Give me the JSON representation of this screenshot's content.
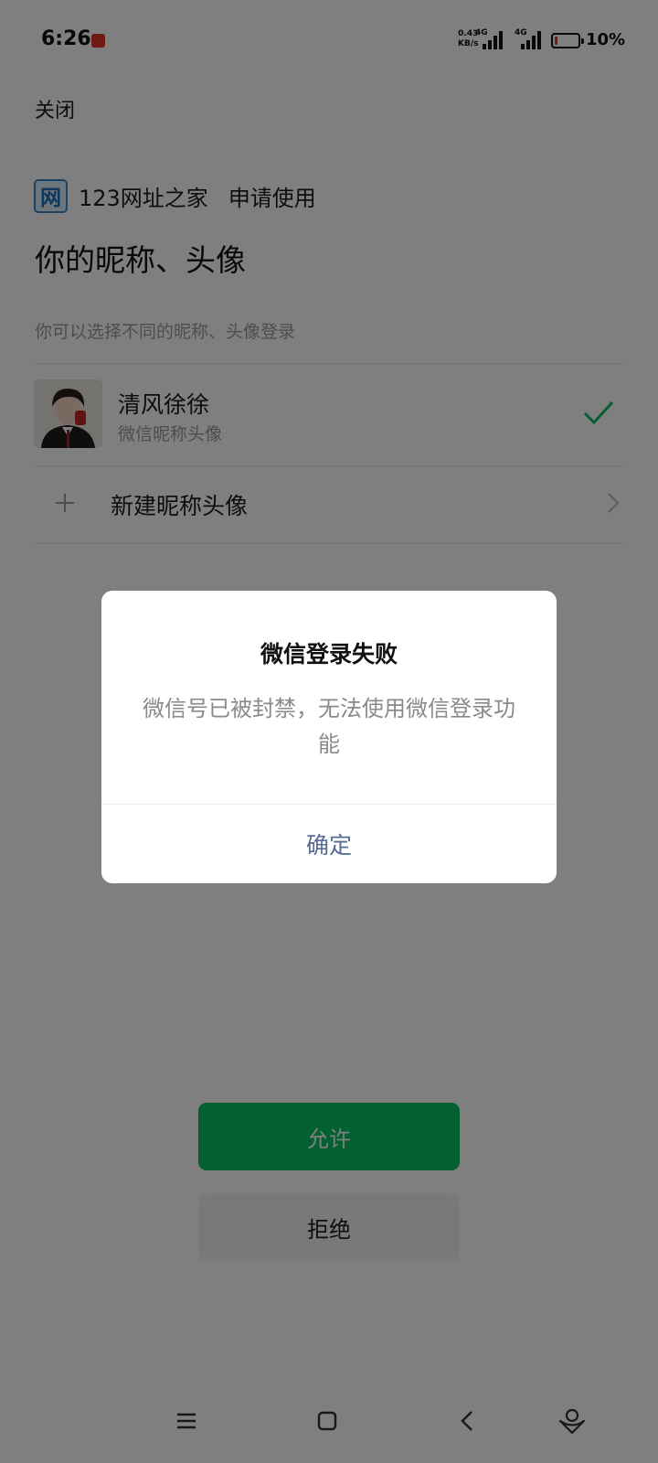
{
  "status_bar": {
    "time": "6:26",
    "net_speed_value": "0.43",
    "net_speed_unit": "KB/s",
    "network_1": "4G",
    "network_2": "4G",
    "battery_percent": "10%",
    "battery_level": 0.1
  },
  "page": {
    "close_label": "关闭",
    "app_icon_glyph": "网",
    "app_name": "123网址之家",
    "request_label": "申请使用",
    "title": "你的昵称、头像",
    "subtitle": "你可以选择不同的昵称、头像登录",
    "profile": {
      "name": "清风徐徐",
      "sub": "微信昵称头像",
      "selected": true
    },
    "new_profile_label": "新建昵称头像",
    "allow_label": "允许",
    "deny_label": "拒绝"
  },
  "dialog": {
    "title": "微信登录失败",
    "message": "微信号已被封禁，无法使用微信登录功能",
    "ok_label": "确定"
  },
  "navbar": {
    "icons": [
      "menu-icon",
      "home-icon",
      "back-icon",
      "assistant-icon"
    ]
  },
  "colors": {
    "brand_green": "#07c160",
    "link_blue": "#576b95",
    "muted_text": "#9a9a9a",
    "overlay": "rgba(0,0,0,0.5)"
  }
}
